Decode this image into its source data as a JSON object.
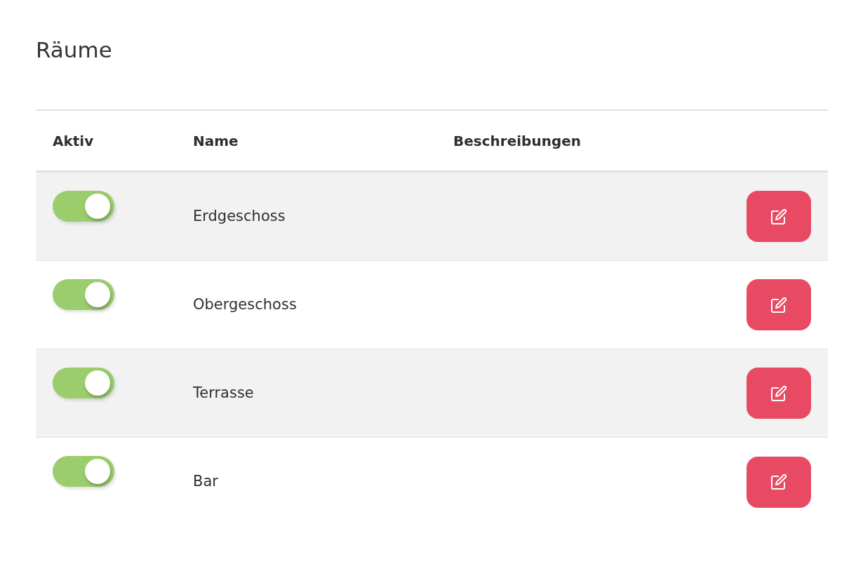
{
  "title": "Räume",
  "table": {
    "columns": [
      "Aktiv",
      "Name",
      "Beschreibungen"
    ],
    "rows": [
      {
        "on": true,
        "name": "Erdgeschoss"
      },
      {
        "on": true,
        "name": "Obergeschoss"
      },
      {
        "on": true,
        "name": "Terrasse"
      },
      {
        "on": true,
        "name": "Bar"
      }
    ]
  }
}
